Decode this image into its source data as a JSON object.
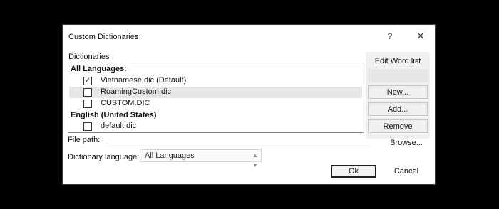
{
  "dialog": {
    "title": "Custom Dictionaries",
    "help_label": "?",
    "close_label": "✕"
  },
  "list": {
    "label": "Dictionaries",
    "groups": [
      {
        "header": "All Languages:",
        "items": [
          {
            "name": "Vietnamese.dic (Default)",
            "checked": "✓"
          },
          {
            "name": "RoamingCustom.dic",
            "checked": ""
          },
          {
            "name": "CUSTOM.DIC",
            "checked": ""
          }
        ]
      },
      {
        "header": "English (United States)",
        "items": [
          {
            "name": "default.dic",
            "checked": ""
          }
        ]
      }
    ]
  },
  "side_buttons": {
    "edit_word_list": "Edit Word list",
    "new": "New...",
    "add": "Add...",
    "remove": "Remove"
  },
  "file_path": {
    "label": "File path:",
    "value": ""
  },
  "browse": "Browse...",
  "dictionary_language": {
    "label": "Dictionary language:",
    "value": "All Languages"
  },
  "ok": "Ok",
  "cancel": "Cancel"
}
